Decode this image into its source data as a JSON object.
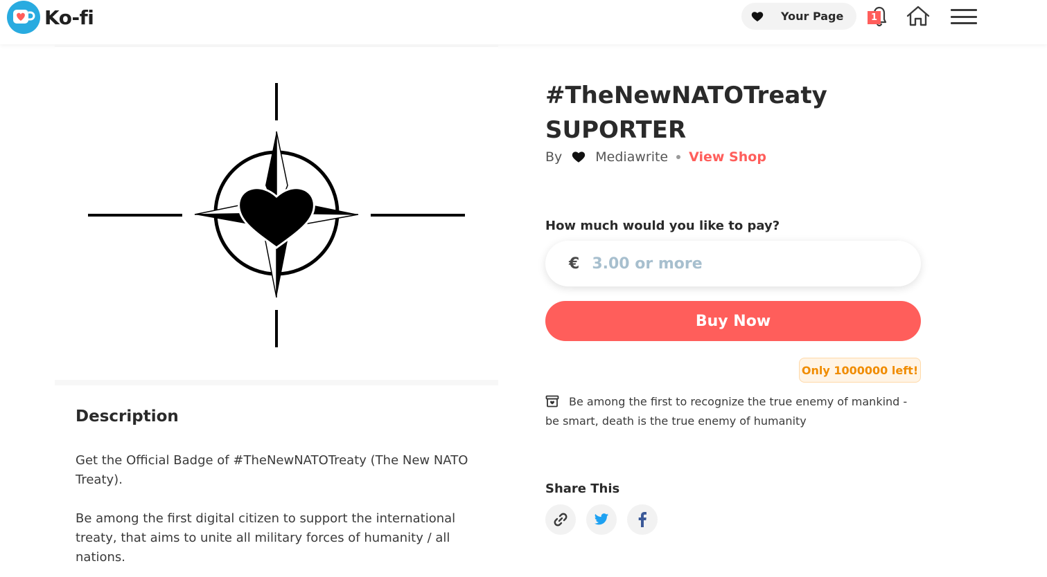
{
  "header": {
    "brand": "Ko-fi",
    "your_page_label": "Your Page",
    "notification_count": "1",
    "icons": [
      "heart-icon",
      "bell-icon",
      "home-icon",
      "menu-icon"
    ]
  },
  "product": {
    "title_line1": "#TheNewNATOTreaty",
    "title_line2": "SUPORTER",
    "by_label": "By",
    "creator": "Mediawrite",
    "view_shop_label": "View Shop"
  },
  "payment": {
    "label": "How much would you like to pay?",
    "currency": "€",
    "placeholder": "3.00 or more",
    "value": "",
    "buy_label": "Buy Now",
    "stock_label": "Only 1000000 left!"
  },
  "note": "Be among the first to recognize the true enemy of mankind - be smart, death is the true enemy of humanity",
  "description": {
    "heading": "Description",
    "paragraph1": "Get the Official Badge of #TheNewNATOTreaty (The New NATO Treaty).",
    "paragraph2": "Be among the first digital citizen to support the international treaty, that aims to unite all military forces of humanity / all nations."
  },
  "share": {
    "heading": "Share This",
    "buttons": [
      "link-icon",
      "twitter-icon",
      "facebook-icon"
    ]
  },
  "colors": {
    "accent": "#ff5e5b",
    "stock_text": "#f08c00",
    "stock_bg": "#fff4e5",
    "logo_blue": "#29abe0",
    "twitter_blue": "#1da1f2",
    "facebook_blue": "#3b5998"
  }
}
